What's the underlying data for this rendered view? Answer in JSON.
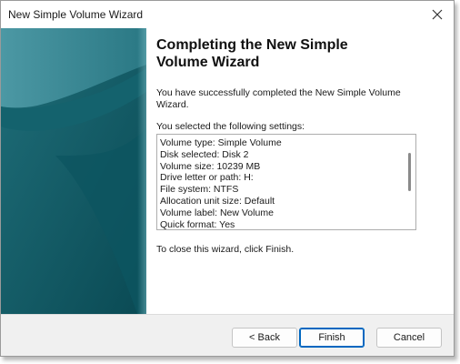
{
  "window": {
    "title": "New Simple Volume Wizard",
    "close_glyph": "close-icon"
  },
  "page": {
    "heading_line1": "Completing the New Simple",
    "heading_line2": "Volume Wizard",
    "success_text": "You have successfully completed the New Simple Volume Wizard.",
    "selected_label": "You selected the following settings:",
    "settings": [
      "Volume type: Simple Volume",
      "Disk selected: Disk 2",
      "Volume size: 10239 MB",
      "Drive letter or path: H:",
      "File system: NTFS",
      "Allocation unit size: Default",
      "Volume label: New Volume",
      "Quick format: Yes"
    ],
    "close_instructions": "To close this wizard, click Finish."
  },
  "buttons": {
    "back": "< Back",
    "finish": "Finish",
    "cancel": "Cancel"
  },
  "colors": {
    "banner_dark": "#0b4f59",
    "banner_light": "#3f8f9c",
    "accent": "#0067c0"
  }
}
